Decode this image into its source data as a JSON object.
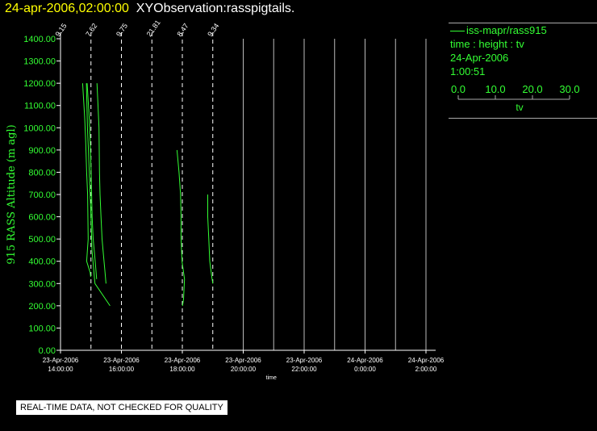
{
  "header": {
    "timestamp": "24-apr-2006,02:00:00",
    "observation": "XYObservation:rasspigtails."
  },
  "legend": {
    "station": "iss-mapr/rass915",
    "axes": "time : height : tv",
    "date": "24-Apr-2006",
    "time": "1:00:51",
    "scale_ticks": [
      "0.0",
      "10.0",
      "20.0",
      "30.0"
    ],
    "scale_label": "tv"
  },
  "notice": "REAL-TIME DATA, NOT CHECKED FOR QUALITY",
  "colors": {
    "axis": "#ffffff",
    "data": "#33ff33",
    "title_timestamp": "#ffff00",
    "label": "#33ff33"
  },
  "chart_data": {
    "type": "line",
    "ylabel": "915 RASS Altitude (m agl)",
    "xlabel": "time",
    "ylim": [
      0,
      1400
    ],
    "yticks": [
      "0.00",
      "100.00",
      "200.00",
      "300.00",
      "400.00",
      "500.00",
      "600.00",
      "700.00",
      "800.00",
      "900.00",
      "1000.00",
      "1100.00",
      "1200.00",
      "1300.00",
      "1400.00"
    ],
    "xrange_hours": [
      14,
      26
    ],
    "xticks": [
      {
        "date": "23-Apr-2006",
        "time": "14:00:00"
      },
      {
        "date": "23-Apr-2006",
        "time": "16:00:00"
      },
      {
        "date": "23-Apr-2006",
        "time": "18:00:00"
      },
      {
        "date": "23-Apr-2006",
        "time": "20:00:00"
      },
      {
        "date": "23-Apr-2006",
        "time": "22:00:00"
      },
      {
        "date": "24-Apr-2006",
        "time": "0:00:00"
      },
      {
        "date": "24-Apr-2006",
        "time": "2:00:00"
      }
    ],
    "profiles": [
      {
        "label": "9.15",
        "base_hour": 14.0
      },
      {
        "label": "7.62",
        "base_hour": 15.0
      },
      {
        "label": "9.75",
        "base_hour": 16.0
      },
      {
        "label": "21.81",
        "base_hour": 17.0
      },
      {
        "label": "8.47",
        "base_hour": 18.0
      },
      {
        "label": "9.34",
        "base_hour": 19.0
      }
    ],
    "tv_scale_hours_per_degree": 0.033,
    "series": [
      {
        "base_hour": 14.0,
        "points": [
          [
            26.5,
            1200
          ],
          [
            28.5,
            1050
          ],
          [
            29.5,
            950
          ],
          [
            30.5,
            800
          ],
          [
            31.5,
            600
          ],
          [
            32.5,
            500
          ],
          [
            34.5,
            400
          ],
          [
            36.0,
            320
          ]
        ]
      },
      {
        "base_hour": 15.0,
        "points": [
          [
            -4.5,
            1200
          ],
          [
            -3.5,
            1000
          ],
          [
            -2.5,
            900
          ],
          [
            0.0,
            600
          ],
          [
            1.0,
            450
          ],
          [
            4.0,
            300
          ],
          [
            19.0,
            200
          ]
        ]
      },
      {
        "base_hour": 14.0,
        "points": [
          [
            22.0,
            1200
          ],
          [
            24.0,
            1050
          ],
          [
            25.0,
            950
          ],
          [
            26.0,
            800
          ],
          [
            27.0,
            700
          ],
          [
            27.5,
            500
          ],
          [
            26.0,
            400
          ],
          [
            29.5,
            350
          ],
          [
            30.0,
            330
          ]
        ]
      },
      {
        "base_hour": 15.0,
        "points": [
          [
            6.0,
            1200
          ],
          [
            7.0,
            1100
          ],
          [
            8.0,
            1000
          ],
          [
            8.5,
            800
          ],
          [
            9.0,
            700
          ],
          [
            10.0,
            600
          ],
          [
            11.0,
            500
          ],
          [
            12.0,
            450
          ],
          [
            14.0,
            350
          ],
          [
            15.0,
            300
          ]
        ]
      },
      {
        "base_hour": 17.0,
        "points": [
          [
            25.0,
            900
          ],
          [
            27.0,
            800
          ],
          [
            28.5,
            700
          ],
          [
            29.0,
            600
          ],
          [
            29.0,
            500
          ],
          [
            29.5,
            450
          ],
          [
            30.0,
            400
          ],
          [
            32.5,
            320
          ],
          [
            31.5,
            230
          ],
          [
            30.5,
            200
          ]
        ]
      },
      {
        "base_hour": 19.0,
        "points": [
          [
            -5.0,
            700
          ],
          [
            -5.0,
            600
          ],
          [
            -4.0,
            500
          ],
          [
            -3.0,
            400
          ],
          [
            -1.0,
            330
          ],
          [
            0.0,
            300
          ]
        ]
      }
    ]
  }
}
